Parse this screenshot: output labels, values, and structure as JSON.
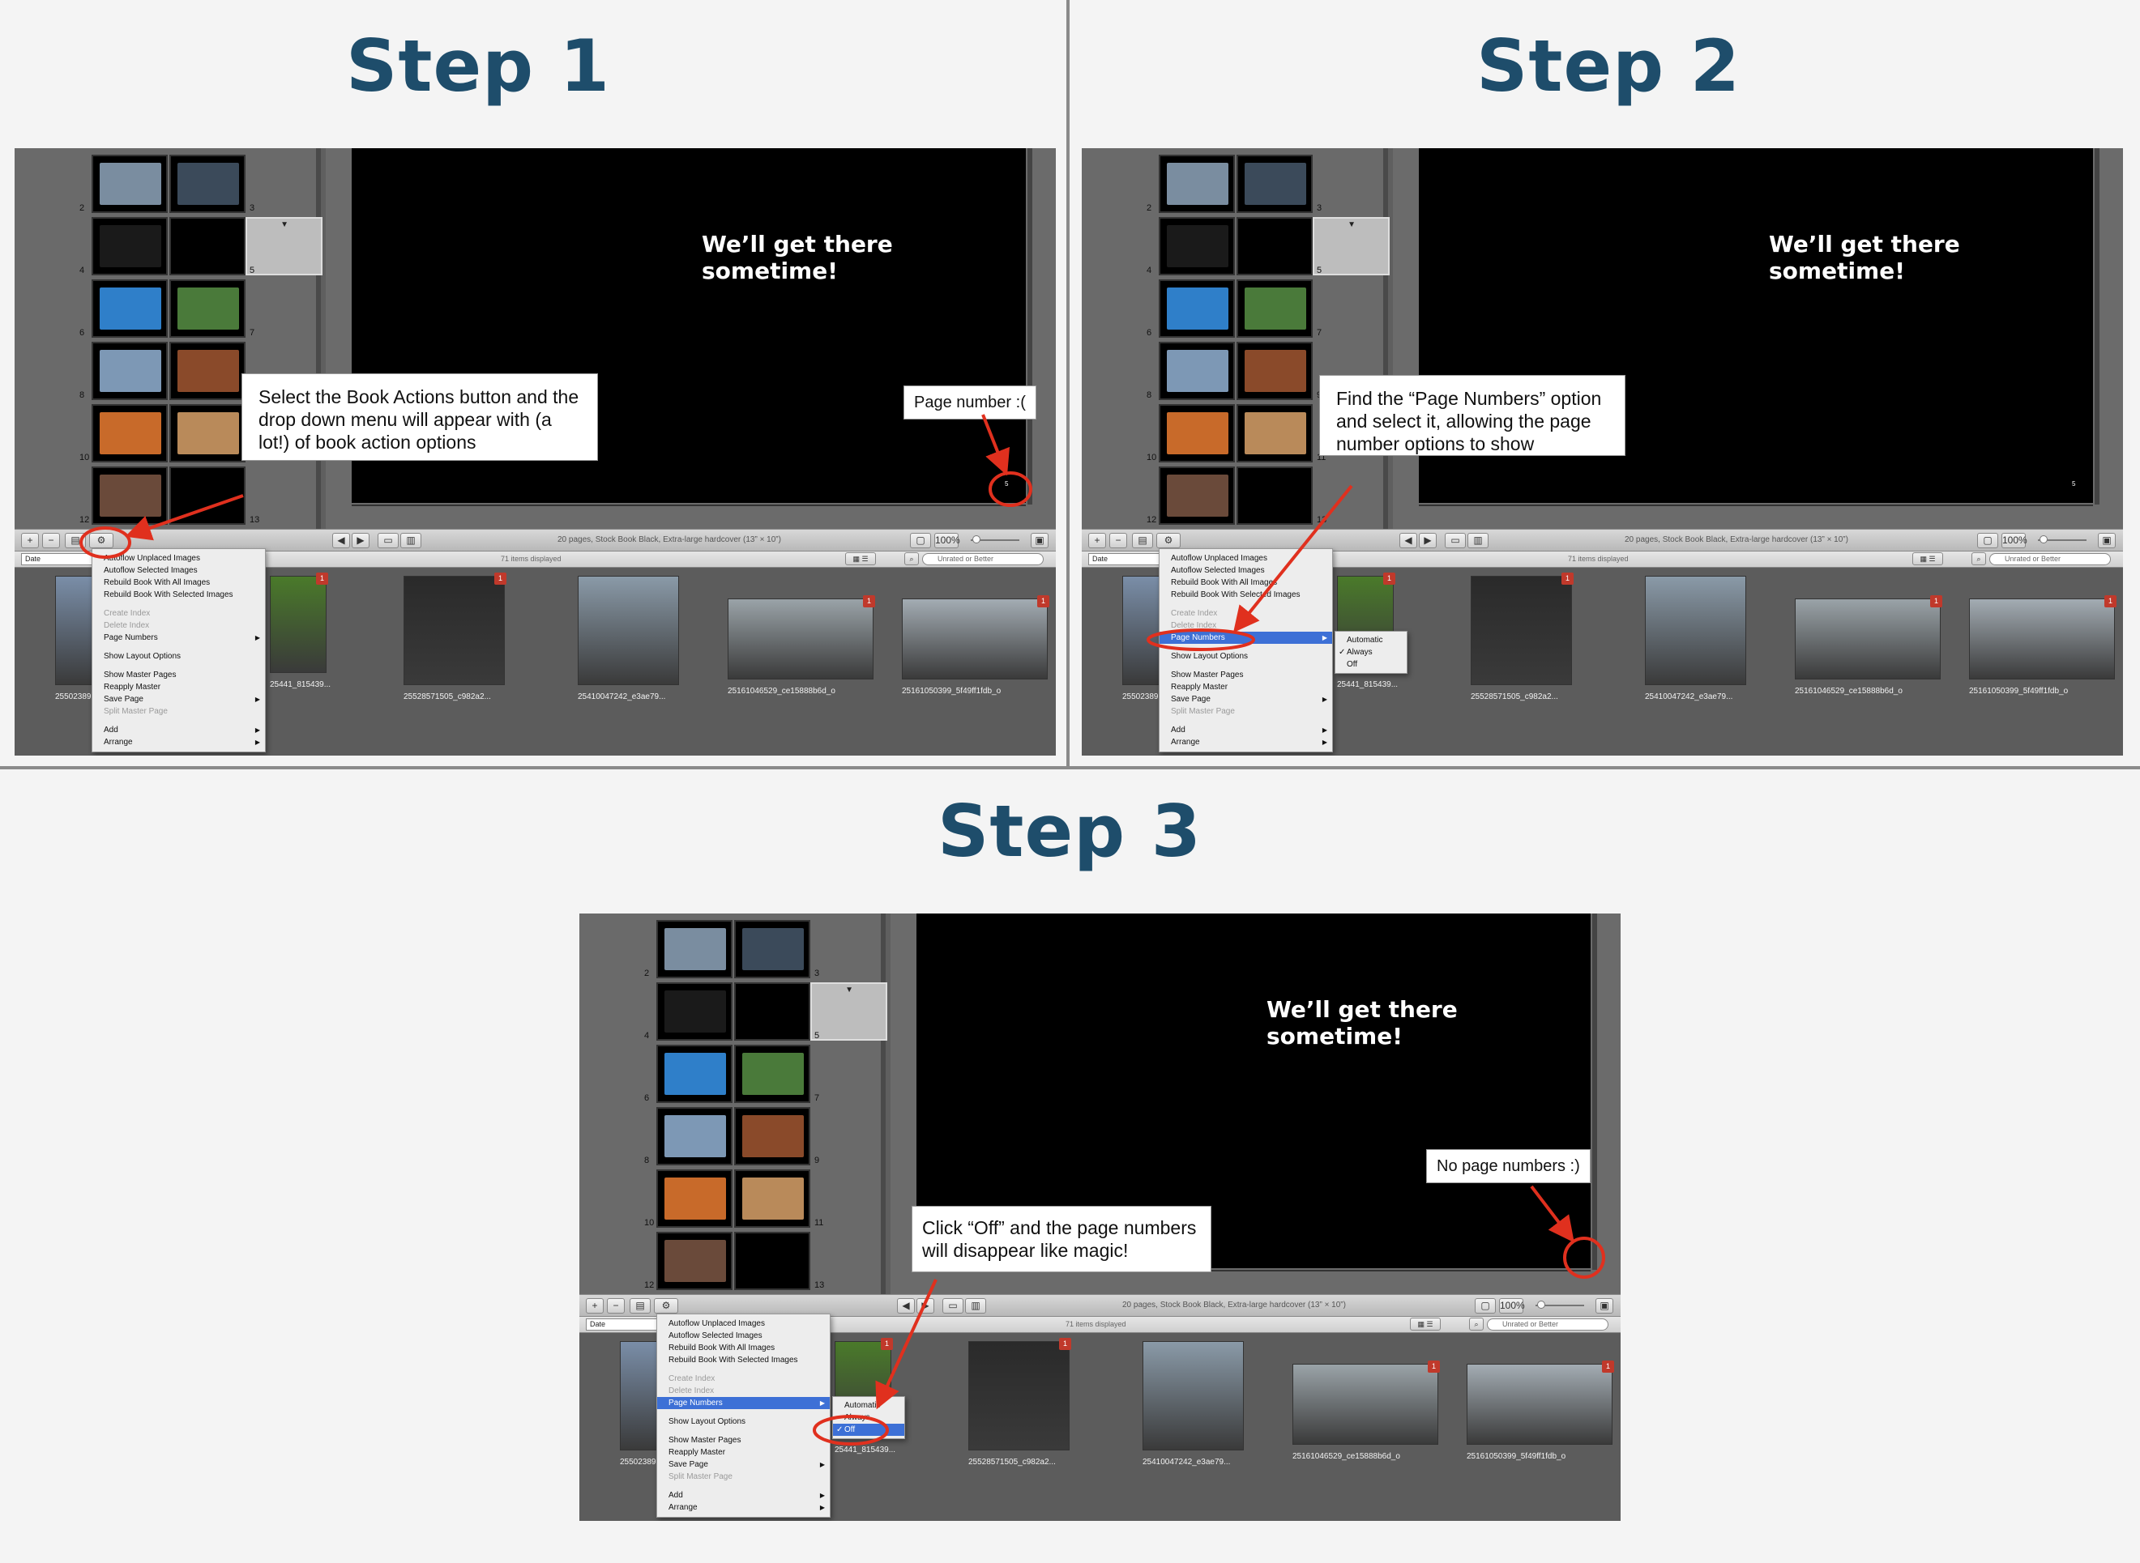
{
  "steps": [
    {
      "title": "Step 1",
      "callout": "Select the Book Actions button and the drop down menu will appear with (a lot!) of book action options",
      "page_callout": "Page number :("
    },
    {
      "title": "Step 2",
      "callout": "Find the “Page Numbers” option and select it, allowing the page number options to show"
    },
    {
      "title": "Step 3",
      "callout": "Click “Off” and the page numbers will disappear like magic!",
      "page_callout": "No page numbers :)"
    }
  ],
  "app": {
    "page_caption": "We’ll get there sometime!",
    "page_number": "5",
    "book_info": "20 pages, Stock Book Black, Extra-large hardcover (13” × 10”)",
    "items_displayed": "71 items displayed",
    "sort_field": "Date",
    "rating_filter": "Unrated or Better",
    "zoom_label": "100%",
    "add_btn": "+",
    "remove_btn": "−",
    "page_labels": [
      "2",
      "3",
      "4",
      "5",
      "6",
      "7",
      "8",
      "9",
      "10",
      "11",
      "12",
      "13"
    ]
  },
  "menu": {
    "items": [
      {
        "label": "Autoflow Unplaced Images",
        "enabled": true
      },
      {
        "label": "Autoflow Selected Images",
        "enabled": true
      },
      {
        "label": "Rebuild Book With All Images",
        "enabled": true
      },
      {
        "label": "Rebuild Book With Selected Images",
        "enabled": true
      },
      {
        "label": "Create Index",
        "enabled": false
      },
      {
        "label": "Delete Index",
        "enabled": false
      },
      {
        "label": "Page Numbers",
        "enabled": true,
        "submenu": true
      },
      {
        "label": "Show Layout Options",
        "enabled": true
      },
      {
        "label": "Show Master Pages",
        "enabled": true
      },
      {
        "label": "Reapply Master",
        "enabled": true
      },
      {
        "label": "Save Page",
        "enabled": true,
        "submenu": true
      },
      {
        "label": "Split Master Page",
        "enabled": false
      },
      {
        "label": "Add",
        "enabled": true,
        "submenu": true
      },
      {
        "label": "Arrange",
        "enabled": true,
        "submenu": true
      }
    ],
    "page_numbers_submenu": [
      {
        "label": "Automatic",
        "checked": false
      },
      {
        "label": "Always",
        "checked": true
      },
      {
        "label": "Off",
        "checked": false
      }
    ],
    "page_numbers_submenu_step3": [
      {
        "label": "Automatic",
        "checked": false
      },
      {
        "label": "Always",
        "checked": false
      },
      {
        "label": "Off",
        "checked": true
      }
    ]
  },
  "browser": {
    "files": [
      {
        "name": "25502389",
        "badge": ""
      },
      {
        "name": "25441_815439...",
        "badge": "1"
      },
      {
        "name": "25528571505_c982a2...",
        "badge": "1"
      },
      {
        "name": "25410047242_e3ae79...",
        "badge": ""
      },
      {
        "name": "25161046529_ce15888b6d_o",
        "badge": "1"
      },
      {
        "name": "25161050399_5f49ff1fdb_o",
        "badge": "1"
      }
    ]
  },
  "colors": {
    "title": "#1e4d6b",
    "annotation_red": "#e0301e",
    "highlight_blue": "#3d70d6"
  }
}
